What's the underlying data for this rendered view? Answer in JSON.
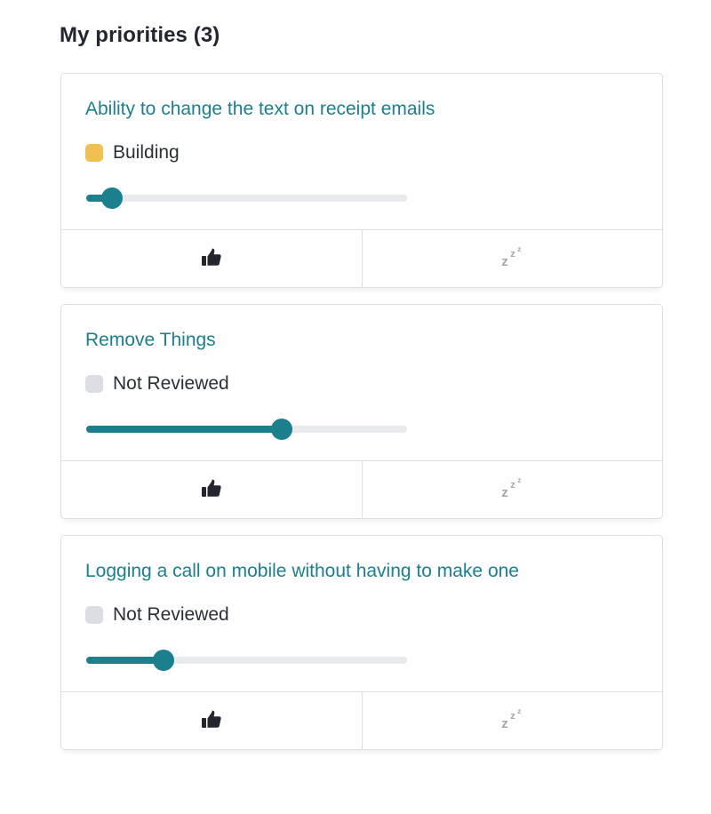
{
  "page": {
    "heading": "My priorities (3)"
  },
  "colors": {
    "accent": "#1b7f8e",
    "track": "#e8eaee",
    "border": "#dcdfe4",
    "status_building": "#f0c050",
    "status_not_reviewed": "#dcdee4",
    "icon_muted": "#a3a8b0"
  },
  "icons": {
    "upvote": "thumbs-up-icon",
    "snooze": "snooze-icon"
  },
  "priorities": [
    {
      "title": "Ability to change the text on receipt emails",
      "status": {
        "label": "Building",
        "color": "#f0c050"
      },
      "priority_level": 0.08
    },
    {
      "title": "Remove Things",
      "status": {
        "label": "Not Reviewed",
        "color": "#dcdee4"
      },
      "priority_level": 0.61
    },
    {
      "title": "Logging a call on mobile without having to make one",
      "status": {
        "label": "Not Reviewed",
        "color": "#dcdee4"
      },
      "priority_level": 0.24
    }
  ]
}
